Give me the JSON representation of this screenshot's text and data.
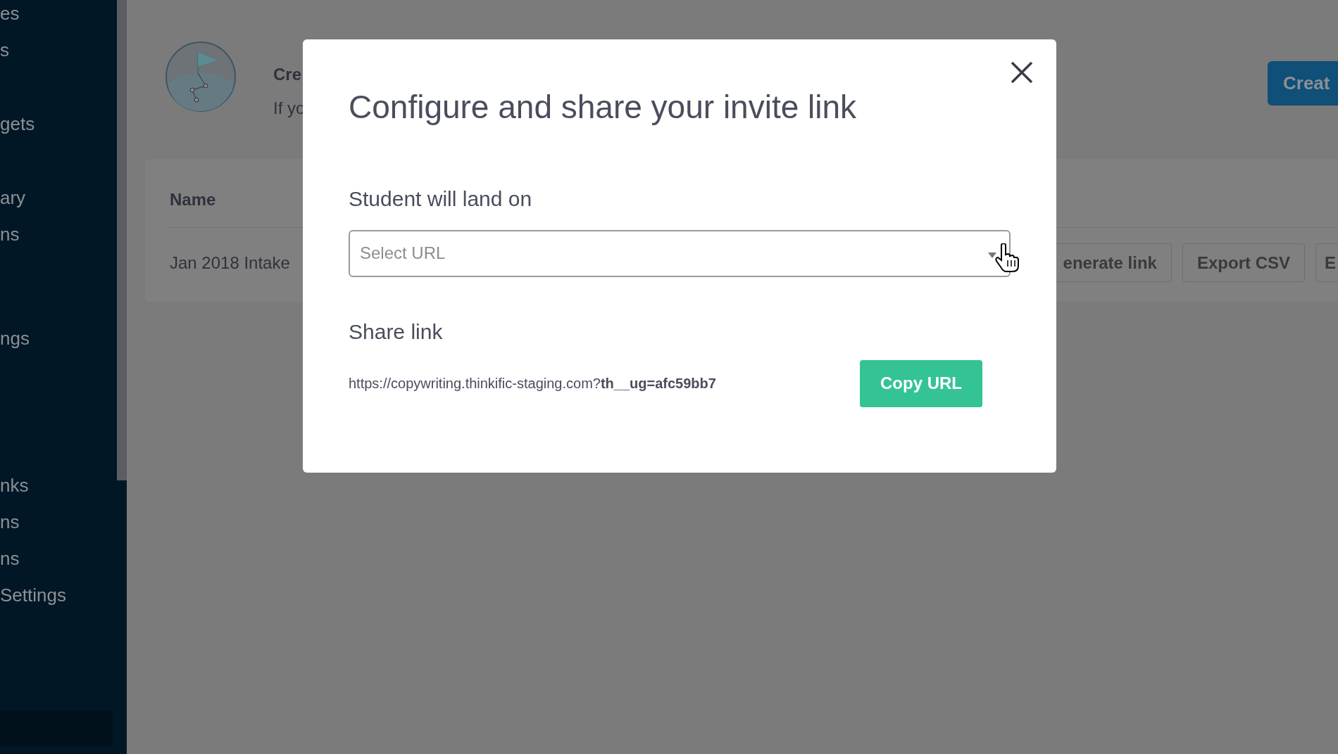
{
  "sidebar": {
    "items": [
      {
        "label": "es"
      },
      {
        "label": "s"
      },
      {
        "label": "gets"
      },
      {
        "label": "ary"
      },
      {
        "label": "ns"
      },
      {
        "label": "ngs"
      },
      {
        "label": "nks"
      },
      {
        "label": "ns"
      },
      {
        "label": "ns"
      },
      {
        "label": "Settings"
      }
    ]
  },
  "header": {
    "title": "Cre",
    "subtitle": "If yo",
    "create_button": "Creat"
  },
  "table": {
    "columns": [
      "Name"
    ],
    "rows": [
      {
        "name": "Jan 2018 Intake",
        "actions": [
          "enerate link",
          "Export CSV",
          "E"
        ]
      }
    ]
  },
  "modal": {
    "title": "Configure and share your invite link",
    "landing_label": "Student will land on",
    "select": {
      "placeholder": "Select URL"
    },
    "share_label": "Share link",
    "share_url": "https://copywriting.thinkific-staging.com?**th__ug=afc59bb7**",
    "copy_button": "Copy URL"
  }
}
